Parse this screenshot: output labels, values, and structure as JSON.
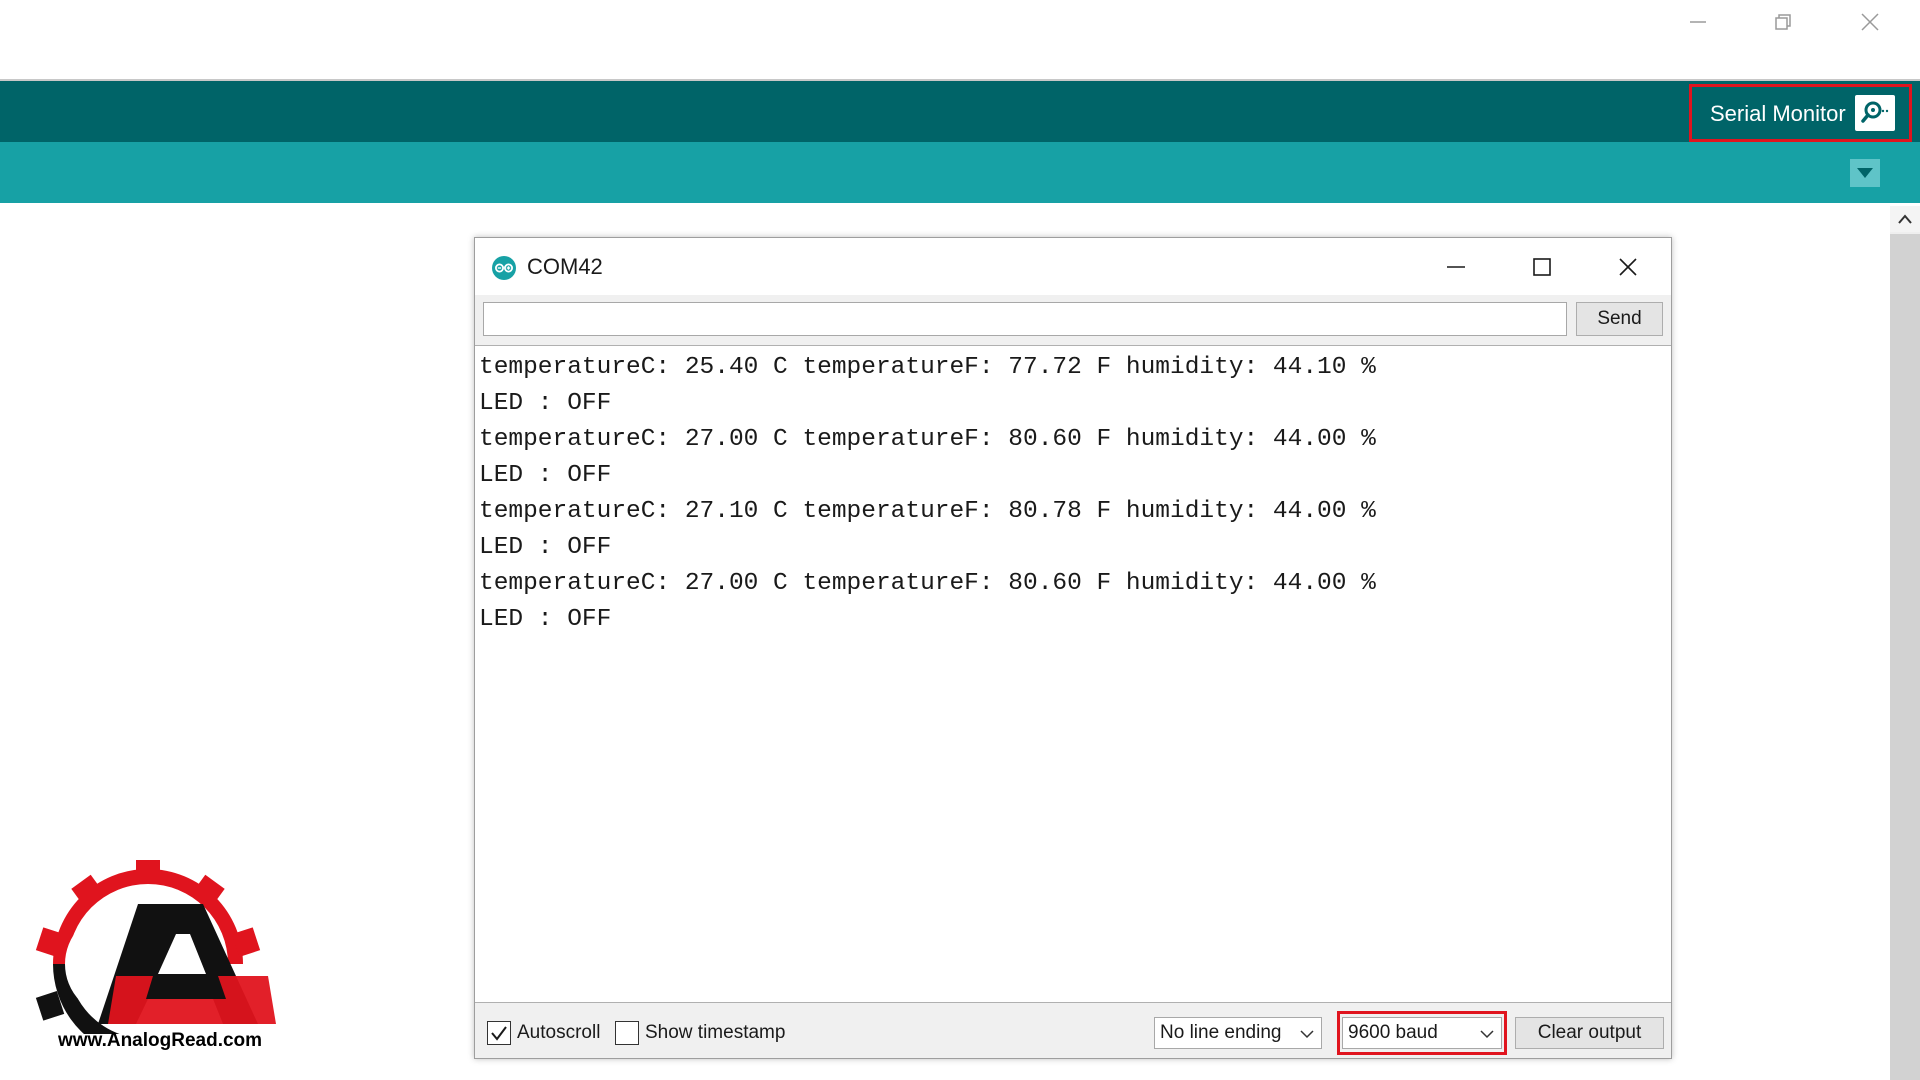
{
  "ide": {
    "serial_monitor_label": "Serial Monitor"
  },
  "monitor": {
    "title": "COM42",
    "send_input_value": "",
    "send_label": "Send",
    "output_lines": [
      "temperatureC: 25.40 C temperatureF: 77.72 F humidity: 44.10 %",
      "LED : OFF",
      "temperatureC: 27.00 C temperatureF: 80.60 F humidity: 44.00 %",
      "LED : OFF",
      "temperatureC: 27.10 C temperatureF: 80.78 F humidity: 44.00 %",
      "LED : OFF",
      "temperatureC: 27.00 C temperatureF: 80.60 F humidity: 44.00 %",
      "LED : OFF"
    ],
    "autoscroll_label": "Autoscroll",
    "autoscroll_checked": true,
    "timestamp_label": "Show timestamp",
    "timestamp_checked": false,
    "line_ending_value": "No line ending",
    "baud_value": "9600 baud",
    "clear_output_label": "Clear output"
  },
  "logo": {
    "text": "www.AnalogRead.com"
  },
  "colors": {
    "toolbar": "#006468",
    "subbar": "#17a1a5",
    "highlight": "#e0141e"
  },
  "icons": {
    "window_minimize": "minimize-icon",
    "window_restore": "restore-icon",
    "window_close": "close-icon",
    "serial_monitor": "magnifier-icon",
    "tab_menu": "triangle-down-icon",
    "monitor_logo": "arduino-logo-icon",
    "scroll_up": "chevron-up-icon",
    "dropdown": "chevron-down-icon"
  }
}
